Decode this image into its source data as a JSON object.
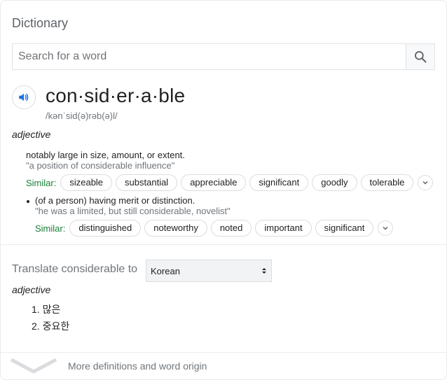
{
  "header": {
    "title": "Dictionary"
  },
  "search": {
    "placeholder": "Search for a word"
  },
  "entry": {
    "headword": "con·sid·er·a·ble",
    "phonetic": "/kənˈsid(ə)rəb(ə)l/",
    "pos": "adjective",
    "senses": [
      {
        "definition": "notably large in size, amount, or extent.",
        "example": "\"a position of considerable influence\"",
        "similar_label": "Similar:",
        "similar": [
          "sizeable",
          "substantial",
          "appreciable",
          "significant",
          "goodly",
          "tolerable"
        ]
      },
      {
        "definition": "(of a person) having merit or distinction.",
        "example": "\"he was a limited, but still considerable, novelist\"",
        "similar_label": "Similar:",
        "similar": [
          "distinguished",
          "noteworthy",
          "noted",
          "important",
          "significant"
        ]
      }
    ]
  },
  "translate": {
    "label": "Translate considerable to",
    "language": "Korean",
    "pos": "adjective",
    "items": [
      "1. 많은",
      "2. 중요한"
    ]
  },
  "footer": {
    "more_label": "More definitions and word origin"
  },
  "icons": {
    "search": "search-icon",
    "speaker": "speaker-icon",
    "expand": "chevron-down-icon",
    "select_arrows": "select-arrows-icon",
    "more": "chevron-down-icon"
  },
  "colors": {
    "accent": "#1a73e8",
    "similar_label": "#188038",
    "muted": "#70757a"
  }
}
